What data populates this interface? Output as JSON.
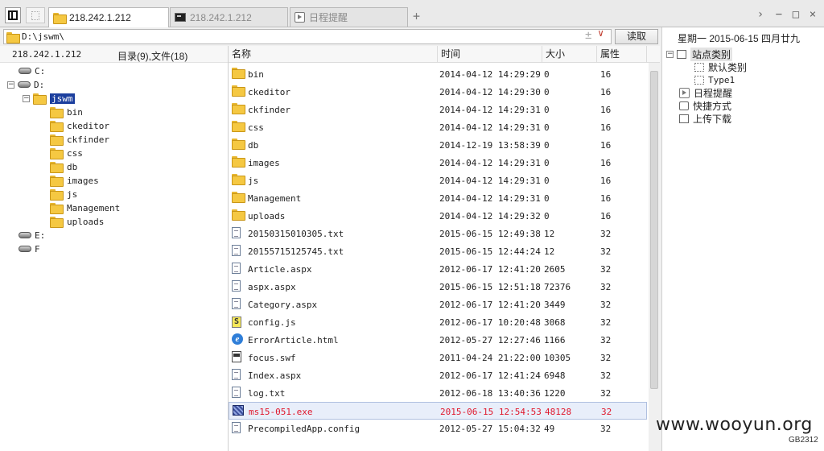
{
  "tabs": [
    {
      "label": "218.242.1.212",
      "icon": "folder-icon",
      "active": true
    },
    {
      "label": "218.242.1.212",
      "icon": "terminal-icon",
      "active": false
    },
    {
      "label": "日程提醒",
      "icon": "calendar-icon",
      "active": false
    }
  ],
  "tabbar": {
    "add_label": "+",
    "scroll_right": "›",
    "minimize": "−",
    "maximize": "□",
    "close": "×"
  },
  "address": {
    "path": "D:\\jswm\\",
    "add_symbol": "±",
    "dropdown": "∨",
    "read_button": "读取"
  },
  "left": {
    "host": "218.242.1.212",
    "summary": "目录(9),文件(18)",
    "tree": {
      "c": "C:",
      "d": "D:",
      "jswm": "jswm",
      "e": "E:",
      "f": "F",
      "folders": [
        "bin",
        "ckeditor",
        "ckfinder",
        "css",
        "db",
        "images",
        "js",
        "Management",
        "uploads"
      ]
    }
  },
  "list": {
    "columns": [
      "名称",
      "时间",
      "大小",
      "属性"
    ],
    "rows": [
      {
        "name": "bin",
        "time": "2014-04-12 14:29:29",
        "size": "0",
        "attr": "16",
        "icon": "folder"
      },
      {
        "name": "ckeditor",
        "time": "2014-04-12 14:29:30",
        "size": "0",
        "attr": "16",
        "icon": "folder"
      },
      {
        "name": "ckfinder",
        "time": "2014-04-12 14:29:31",
        "size": "0",
        "attr": "16",
        "icon": "folder"
      },
      {
        "name": "css",
        "time": "2014-04-12 14:29:31",
        "size": "0",
        "attr": "16",
        "icon": "folder"
      },
      {
        "name": "db",
        "time": "2014-12-19 13:58:39",
        "size": "0",
        "attr": "16",
        "icon": "folder"
      },
      {
        "name": "images",
        "time": "2014-04-12 14:29:31",
        "size": "0",
        "attr": "16",
        "icon": "folder"
      },
      {
        "name": "js",
        "time": "2014-04-12 14:29:31",
        "size": "0",
        "attr": "16",
        "icon": "folder"
      },
      {
        "name": "Management",
        "time": "2014-04-12 14:29:31",
        "size": "0",
        "attr": "16",
        "icon": "folder"
      },
      {
        "name": "uploads",
        "time": "2014-04-12 14:29:32",
        "size": "0",
        "attr": "16",
        "icon": "folder"
      },
      {
        "name": "20150315010305.txt",
        "time": "2015-06-15 12:49:38",
        "size": "12",
        "attr": "32",
        "icon": "text"
      },
      {
        "name": "20155715125745.txt",
        "time": "2015-06-15 12:44:24",
        "size": "12",
        "attr": "32",
        "icon": "text"
      },
      {
        "name": "Article.aspx",
        "time": "2012-06-17 12:41:20",
        "size": "2605",
        "attr": "32",
        "icon": "text"
      },
      {
        "name": "aspx.aspx",
        "time": "2015-06-15 12:51:18",
        "size": "72376",
        "attr": "32",
        "icon": "text"
      },
      {
        "name": "Category.aspx",
        "time": "2012-06-17 12:41:20",
        "size": "3449",
        "attr": "32",
        "icon": "text"
      },
      {
        "name": "config.js",
        "time": "2012-06-17 10:20:48",
        "size": "3068",
        "attr": "32",
        "icon": "js"
      },
      {
        "name": "ErrorArticle.html",
        "time": "2012-05-27 12:27:46",
        "size": "1166",
        "attr": "32",
        "icon": "ie"
      },
      {
        "name": "focus.swf",
        "time": "2011-04-24 21:22:00",
        "size": "10305",
        "attr": "32",
        "icon": "swf"
      },
      {
        "name": "Index.aspx",
        "time": "2012-06-17 12:41:24",
        "size": "6948",
        "attr": "32",
        "icon": "text"
      },
      {
        "name": "log.txt",
        "time": "2012-06-18 13:40:36",
        "size": "1220",
        "attr": "32",
        "icon": "text"
      },
      {
        "name": "ms15-051.exe",
        "time": "2015-06-15 12:54:53",
        "size": "48128",
        "attr": "32",
        "icon": "exe",
        "highlight": true
      },
      {
        "name": "PrecompiledApp.config",
        "time": "2012-05-27 15:04:32",
        "size": "49",
        "attr": "32",
        "icon": "text"
      }
    ]
  },
  "right": {
    "date": "星期一 2015-06-15 四月廿九",
    "site_category": "站点类别",
    "default_category": "默认类别",
    "type1": "Type1",
    "schedule": "日程提醒",
    "shortcut": "快捷方式",
    "upload": "上传下载"
  },
  "watermark": "www.wooyun.org",
  "encoding": "GB2312"
}
